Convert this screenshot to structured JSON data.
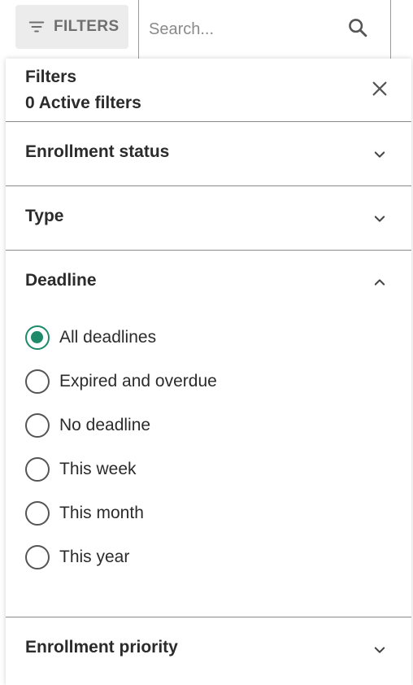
{
  "toolbar": {
    "filters_label": "FILTERS",
    "search_placeholder": "Search..."
  },
  "panel": {
    "title": "Filters",
    "active_count": "0 Active filters"
  },
  "sections": [
    {
      "label": "Enrollment status",
      "expanded": false
    },
    {
      "label": "Type",
      "expanded": false
    },
    {
      "label": "Deadline",
      "expanded": true,
      "options": [
        {
          "label": "All deadlines",
          "selected": true
        },
        {
          "label": "Expired and overdue",
          "selected": false
        },
        {
          "label": "No deadline",
          "selected": false
        },
        {
          "label": "This week",
          "selected": false
        },
        {
          "label": "This month",
          "selected": false
        },
        {
          "label": "This year",
          "selected": false
        }
      ]
    },
    {
      "label": "Enrollment priority",
      "expanded": false
    }
  ],
  "colors": {
    "accent": "#1e8a6a",
    "filters_button_bg": "#ececec"
  },
  "icons": {
    "filter": "filter-lines-icon",
    "search": "search-icon",
    "close": "close-icon",
    "collapsed": "chevron-down-icon",
    "expanded": "chevron-up-icon"
  }
}
